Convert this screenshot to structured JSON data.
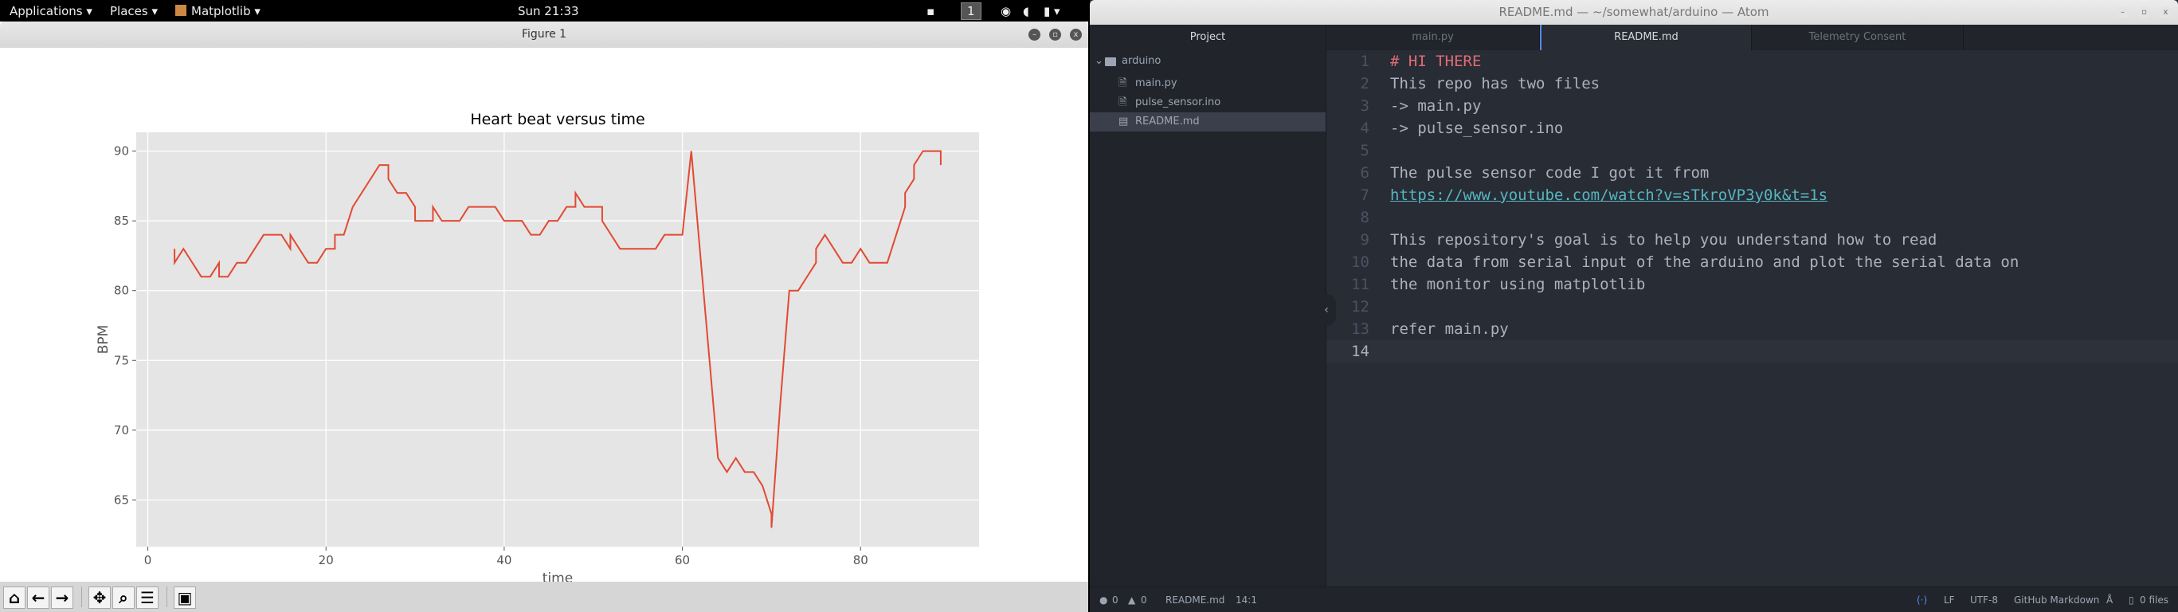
{
  "topbar": {
    "applications": "Applications ▾",
    "places": "Places ▾",
    "app": "Matplotlib ▾",
    "clock": "Sun 21:33",
    "workspace": "1"
  },
  "figure_window": {
    "title": "Figure 1",
    "toolbar": [
      "home",
      "back",
      "forward",
      "pan",
      "zoom",
      "configure",
      "save"
    ]
  },
  "chart_data": {
    "type": "line",
    "title": "Heart beat versus time",
    "xlabel": "time",
    "ylabel": "BPM",
    "xlim": [
      -1.3,
      93.3
    ],
    "ylim": [
      61.65,
      91.35
    ],
    "xticks": [
      0,
      20,
      40,
      60,
      80
    ],
    "yticks": [
      65,
      70,
      75,
      80,
      85,
      90
    ],
    "grid": true,
    "style": "ggplot",
    "line_color": "#e24a33",
    "x": [
      3,
      3,
      4,
      6,
      7,
      8,
      8,
      9,
      10,
      11,
      13,
      15,
      16,
      16,
      18,
      19,
      20,
      21,
      21,
      22,
      23,
      26,
      27,
      27,
      28,
      29,
      30,
      30,
      32,
      32,
      33,
      35,
      36,
      39,
      40,
      42,
      43,
      44,
      45,
      46,
      47,
      48,
      48,
      49,
      51,
      51,
      53,
      57,
      58,
      60,
      61,
      64,
      65,
      66,
      67,
      68,
      69,
      70,
      70,
      71,
      72,
      73,
      75,
      75,
      76,
      78,
      79,
      80,
      81,
      83,
      85,
      85,
      86,
      86,
      87,
      89,
      89
    ],
    "y": [
      83,
      82,
      83,
      81,
      81,
      82,
      81,
      81,
      82,
      82,
      84,
      84,
      83,
      84,
      82,
      82,
      83,
      83,
      84,
      84,
      86,
      89,
      89,
      88,
      87,
      87,
      86,
      85,
      85,
      86,
      85,
      85,
      86,
      86,
      85,
      85,
      84,
      84,
      85,
      85,
      86,
      86,
      87,
      86,
      86,
      85,
      83,
      83,
      84,
      84,
      90,
      68,
      67,
      68,
      67,
      67,
      66,
      64,
      63,
      72,
      80,
      80,
      82,
      83,
      84,
      82,
      82,
      83,
      82,
      82,
      86,
      87,
      88,
      89,
      90,
      90,
      89
    ]
  },
  "atom": {
    "title": "README.md — ~/somewhat/arduino — Atom",
    "tabs": [
      {
        "label": "Project"
      },
      {
        "label": "main.py"
      },
      {
        "label": "README.md"
      },
      {
        "label": "Telemetry Consent"
      }
    ],
    "tree": {
      "folder": "arduino",
      "files": [
        "main.py",
        "pulse_sensor.ino",
        "README.md"
      ]
    },
    "lines": [
      "# HI THERE",
      "This repo has two files",
      "-> main.py",
      "-> pulse_sensor.ino",
      "",
      "The pulse sensor code I got it from",
      "https://www.youtube.com/watch?v=sTkroVP3y0k&t=1s",
      "",
      "This repository's goal is to help you understand how to read",
      "the data from serial input of the arduino and plot the serial data on",
      "the monitor using matplotlib",
      "",
      "refer main.py",
      ""
    ],
    "status": {
      "errors": "0",
      "warnings": "0",
      "file": "README.md",
      "cursor": "14:1",
      "eol": "LF",
      "encoding": "UTF-8",
      "grammar": "GitHub Markdown",
      "files": "0 files"
    }
  }
}
